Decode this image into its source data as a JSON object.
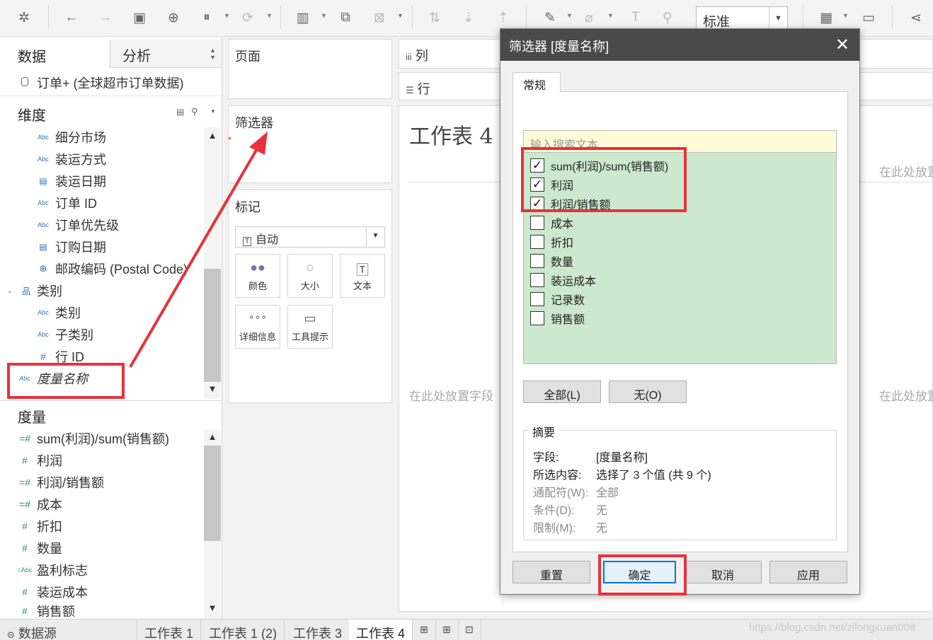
{
  "toolbar": {
    "view_mode": "标准"
  },
  "left_pane": {
    "tabs": {
      "data": "数据",
      "analysis": "分析"
    },
    "datasource": "订单+ (全球超市订单数据)",
    "dimensions_header": "维度",
    "dimensions": [
      {
        "icon": "Abc",
        "label": "细分市场"
      },
      {
        "icon": "Abc",
        "label": "装运方式"
      },
      {
        "icon": "cal",
        "label": "装运日期"
      },
      {
        "icon": "Abc",
        "label": "订单 ID"
      },
      {
        "icon": "Abc",
        "label": "订单优先级"
      },
      {
        "icon": "cal",
        "label": "订购日期"
      },
      {
        "icon": "globe",
        "label": "邮政编码 (Postal Code)"
      },
      {
        "icon": "hier",
        "label": "类别"
      },
      {
        "icon": "Abc",
        "label": "类别"
      },
      {
        "icon": "Abc",
        "label": "子类别"
      },
      {
        "icon": "#",
        "label": "行 ID"
      },
      {
        "icon": "Abc",
        "label": "度量名称"
      }
    ],
    "measures_header": "度量",
    "measures": [
      {
        "icon": "=#",
        "label": "sum(利润)/sum(销售额)"
      },
      {
        "icon": "#",
        "label": "利润"
      },
      {
        "icon": "=#",
        "label": "利润/销售额"
      },
      {
        "icon": "=#",
        "label": "成本"
      },
      {
        "icon": "#",
        "label": "折扣"
      },
      {
        "icon": "#",
        "label": "数量"
      },
      {
        "icon": "=Abc",
        "label": "盈利标志"
      },
      {
        "icon": "#",
        "label": "装运成本"
      },
      {
        "icon": "#",
        "label": "销售额"
      }
    ]
  },
  "shelves": {
    "pages": "页面",
    "filters": "筛选器",
    "columns": "列",
    "rows": "行"
  },
  "marks": {
    "title": "标记",
    "type": "自动",
    "buttons": {
      "color": "颜色",
      "size": "大小",
      "text": "文本",
      "detail": "详细信息",
      "tooltip": "工具提示"
    }
  },
  "sheet": {
    "title": "工作表 4",
    "drop_field": "在此处放置字段",
    "drop_right": "在此处放置"
  },
  "bottom_tabs": {
    "datasource": "数据源",
    "sheets": [
      "工作表 1",
      "工作表 1 (2)",
      "工作表 3",
      "工作表 4"
    ],
    "watermark": "https://blog.csdn.net/zilongxuan008"
  },
  "dialog": {
    "title": "筛选器 [度量名称]",
    "tab": "常规",
    "search_placeholder": "输入搜索文本",
    "items": [
      {
        "label": "sum(利润)/sum(销售额)",
        "checked": true
      },
      {
        "label": "利润",
        "checked": true
      },
      {
        "label": "利润/销售额",
        "checked": true
      },
      {
        "label": "成本",
        "checked": false
      },
      {
        "label": "折扣",
        "checked": false
      },
      {
        "label": "数量",
        "checked": false
      },
      {
        "label": "装运成本",
        "checked": false
      },
      {
        "label": "记录数",
        "checked": false
      },
      {
        "label": "销售额",
        "checked": false
      }
    ],
    "all_btn": "全部(L)",
    "none_btn": "无(O)",
    "summary": {
      "title": "摘要",
      "rows": [
        {
          "key": "字段:",
          "value": "[度量名称]",
          "dim": false
        },
        {
          "key": "所选内容:",
          "value": "选择了 3 个值 (共 9 个)",
          "dim": false
        },
        {
          "key": "通配符(W):",
          "value": "全部",
          "dim": true
        },
        {
          "key": "条件(D):",
          "value": "无",
          "dim": true
        },
        {
          "key": "限制(M):",
          "value": "无",
          "dim": true
        }
      ]
    },
    "buttons": {
      "reset": "重置",
      "ok": "确定",
      "cancel": "取消",
      "apply": "应用"
    }
  },
  "colors": {
    "annotation_red": "#e8313a",
    "list_green": "#cce8cf",
    "search_yellow": "#fffbd6",
    "title_bar": "#4a4a4a"
  }
}
